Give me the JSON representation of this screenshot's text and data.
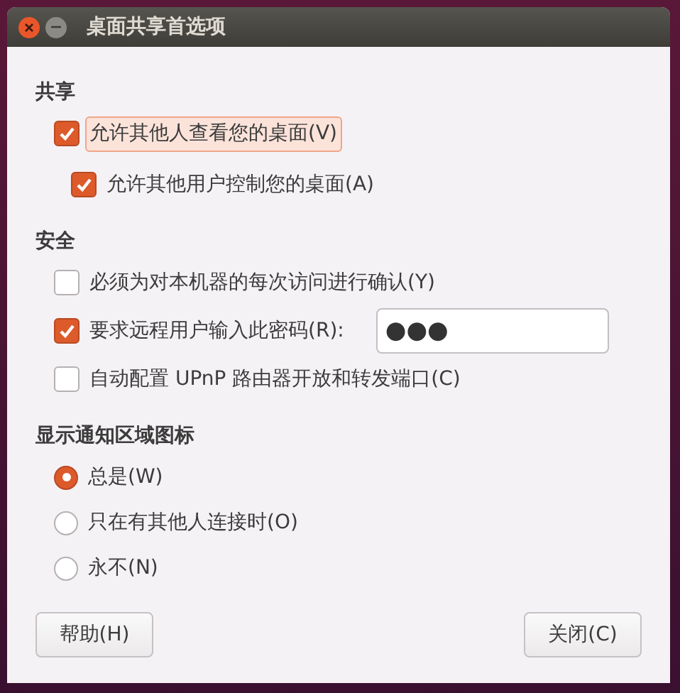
{
  "window": {
    "title": "桌面共享首选项"
  },
  "sections": [
    {
      "title": "共享",
      "items": [
        {
          "kind": "checkbox",
          "label": "允许其他人查看您的桌面(V)",
          "checked": true,
          "focused": true,
          "children": [
            {
              "kind": "checkbox",
              "label": "允许其他用户控制您的桌面(A)",
              "checked": true,
              "focused": false
            }
          ]
        }
      ]
    },
    {
      "title": "安全",
      "items": [
        {
          "kind": "checkbox",
          "label": "必须为对本机器的每次访问进行确认(Y)",
          "checked": false,
          "focused": false
        },
        {
          "kind": "password",
          "label": "要求远程用户输入此密码(R):",
          "checked": true,
          "focused": false,
          "value": "●●●"
        },
        {
          "kind": "checkbox",
          "label": "自动配置 UPnP 路由器开放和转发端口(C)",
          "checked": false,
          "focused": false
        }
      ]
    },
    {
      "title": "显示通知区域图标",
      "items": [
        {
          "kind": "radio",
          "label": "总是(W)",
          "selected": true,
          "focused": false
        },
        {
          "kind": "radio",
          "label": "只在有其他人连接时(O)",
          "selected": false,
          "focused": false
        },
        {
          "kind": "radio",
          "label": "永不(N)",
          "selected": false,
          "focused": false
        }
      ]
    }
  ],
  "buttons": [
    "帮助(H)",
    "关闭(C)"
  ]
}
